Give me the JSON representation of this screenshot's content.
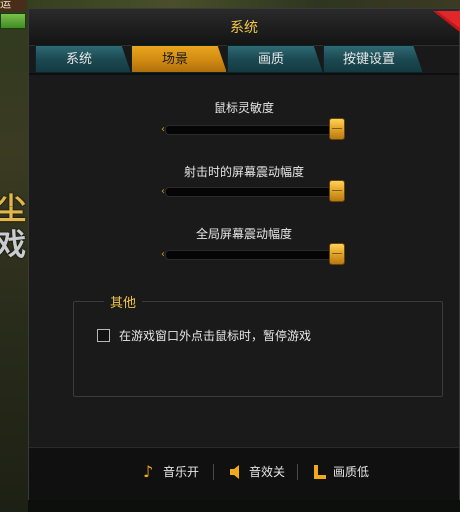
{
  "background": {
    "corner_text": "运",
    "glyph_1": "尘",
    "glyph_2": "戏"
  },
  "dialog": {
    "title": "系统",
    "close_icon": "close-icon",
    "tabs": [
      {
        "label": "系统",
        "active": false
      },
      {
        "label": "场景",
        "active": true
      },
      {
        "label": "画质",
        "active": false
      },
      {
        "label": "按键设置",
        "active": false
      }
    ],
    "sliders": [
      {
        "label": "鼠标灵敏度",
        "value": 1.0
      },
      {
        "label": "射击时的屏幕震动幅度",
        "value": 1.0
      },
      {
        "label": "全局屏幕震动幅度",
        "value": 1.0
      }
    ],
    "other_group": {
      "title": "其他",
      "checkbox_label": "在游戏窗口外点击鼠标时，暂停游戏",
      "checked": false
    },
    "footer": {
      "music_label": "音乐开",
      "sound_label": "音效关",
      "quality_label": "画质低"
    }
  },
  "colors": {
    "accent_gold": "#f0c64a",
    "tab_active": "#e9a51e",
    "tab_inactive": "#1c4a52",
    "panel_bg": "#1a1a1a"
  }
}
